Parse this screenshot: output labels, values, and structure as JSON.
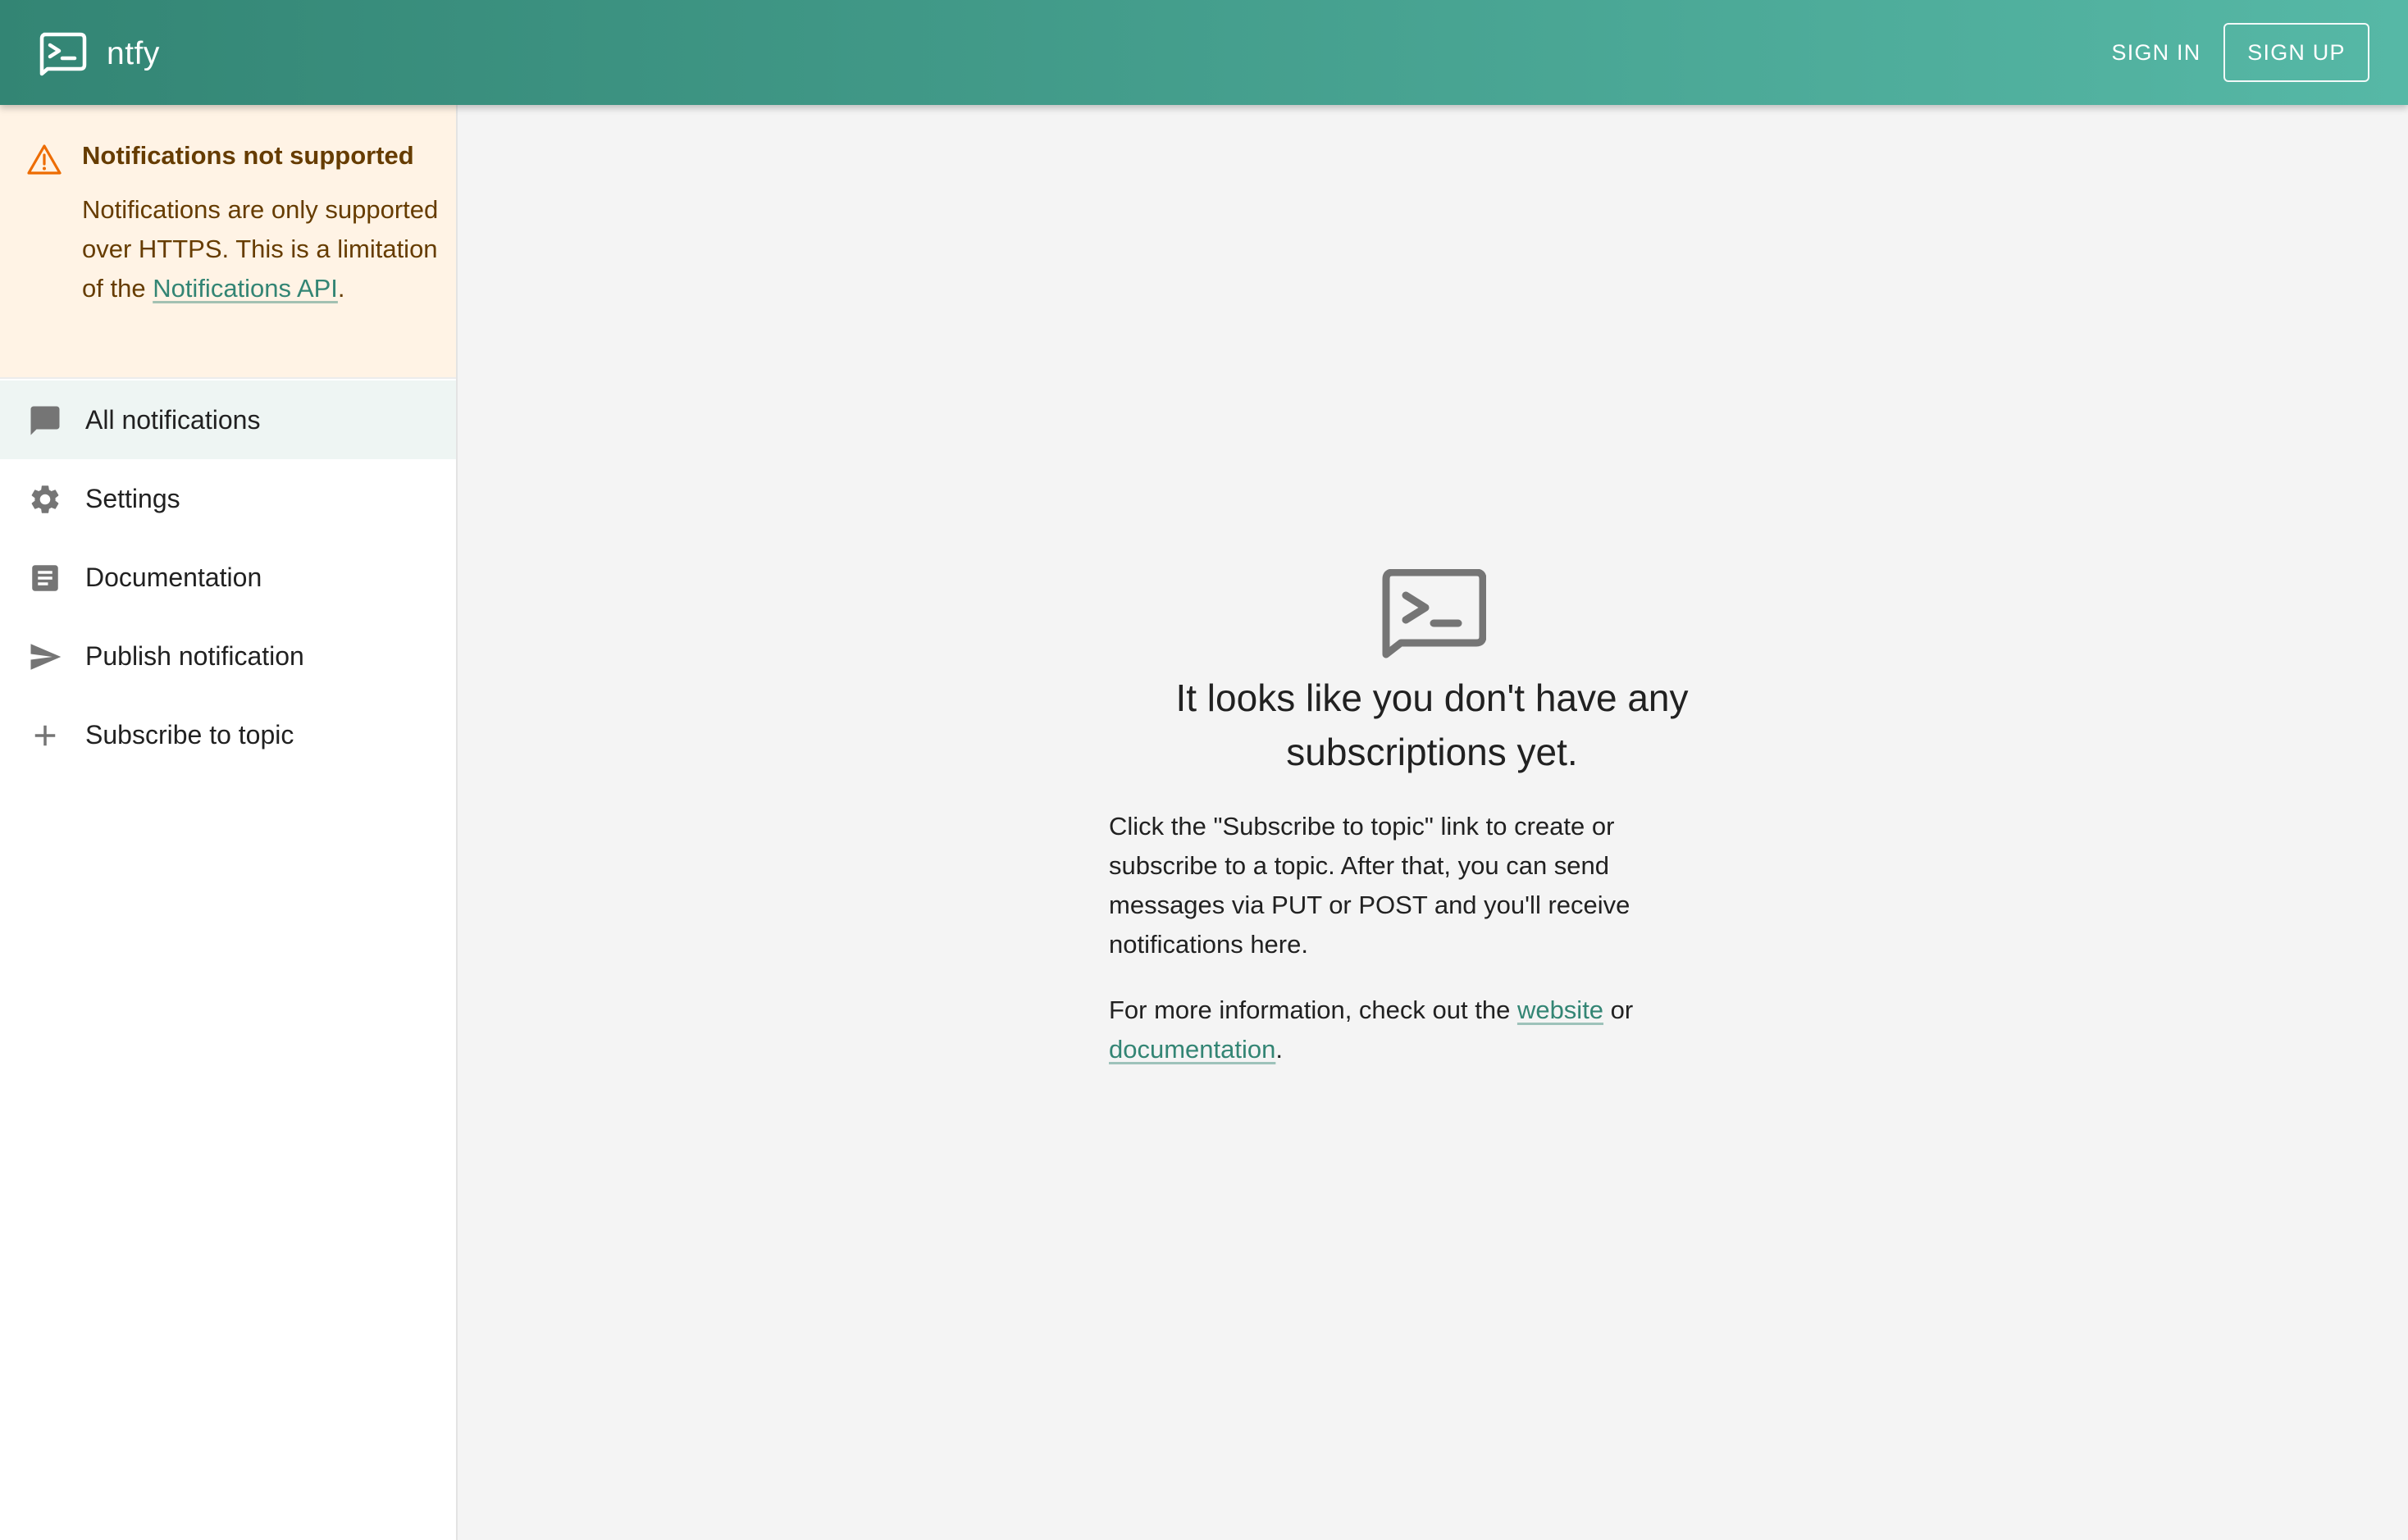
{
  "app": {
    "name": "ntfy",
    "icon": "ntfy-logo-icon"
  },
  "header": {
    "signin_label": "SIGN IN",
    "signup_label": "SIGN UP"
  },
  "alert": {
    "icon": "warning-icon",
    "title": "Notifications not supported",
    "body_text": "Notifications are only supported over HTTPS. This is a limitation of the ",
    "link_text": "Notifications API",
    "body_end": "."
  },
  "sidebar": {
    "items": [
      {
        "label": "All notifications",
        "icon": "chat-bubble-icon",
        "selected": true
      },
      {
        "label": "Settings",
        "icon": "gear-icon",
        "selected": false
      },
      {
        "label": "Documentation",
        "icon": "document-icon",
        "selected": false
      },
      {
        "label": "Publish notification",
        "icon": "send-icon",
        "selected": false
      },
      {
        "label": "Subscribe to topic",
        "icon": "plus-icon",
        "selected": false
      }
    ]
  },
  "main": {
    "empty_icon": "ntfy-logo-icon",
    "title_line1": "It looks like you don't have any",
    "title_line2": "subscriptions yet.",
    "para1": "Click the \"Subscribe to topic\" link to create or subscribe to a topic. After that, you can send messages via PUT or POST and you'll receive notifications here.",
    "para2_prefix": "For more information, check out the ",
    "website_link": "website",
    "para2_middle": " or ",
    "documentation_link": "documentation",
    "para2_suffix": "."
  },
  "colors": {
    "appbar_start": "#338574",
    "appbar_end": "#56b8a6",
    "accent": "#338574",
    "alert_bg": "#fff3e5",
    "alert_text": "#663c00",
    "warning_icon": "#ed6c02",
    "icon_gray": "#757575"
  }
}
